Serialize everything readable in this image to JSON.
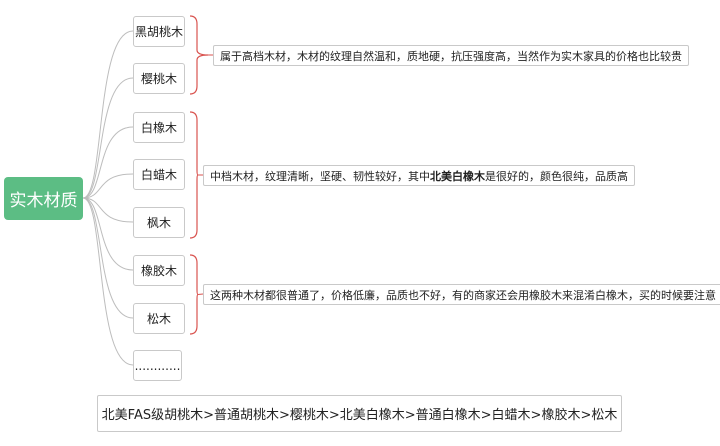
{
  "root": {
    "label": "实木材质"
  },
  "nodes": [
    {
      "id": "n0",
      "label": "黑胡桃木"
    },
    {
      "id": "n1",
      "label": "樱桃木"
    },
    {
      "id": "n2",
      "label": "白橡木"
    },
    {
      "id": "n3",
      "label": "白蜡木"
    },
    {
      "id": "n4",
      "label": "枫木"
    },
    {
      "id": "n5",
      "label": "橡胶木"
    },
    {
      "id": "n6",
      "label": "松木"
    },
    {
      "id": "n7",
      "label": "............"
    }
  ],
  "groups": [
    {
      "note_text": "属于高档木材，木材的纹理自然温和，质地硬，抗压强度高，当然作为实木家具的价格也比较贵"
    },
    {
      "note_before": "中档木材，纹理清晰，坚硬、韧性较好，其中",
      "note_bold": "北美白橡木",
      "note_after": "是很好的，颜色很纯，品质高"
    },
    {
      "note_text": "这两种木材都很普通了，价格低廉，品质也不好，有的商家还会用橡胶木来混淆白橡木，买的时候要注意"
    }
  ],
  "summary": {
    "text": "北美FAS级胡桃木>普通胡桃木>樱桃木>北美白橡木>普通白橡木>白蜡木>橡胶木>松木"
  },
  "colors": {
    "root_bg": "#5cbd84",
    "bracket": "#d9534f",
    "connector": "#bdbdbd",
    "border": "#c9c9c9"
  }
}
